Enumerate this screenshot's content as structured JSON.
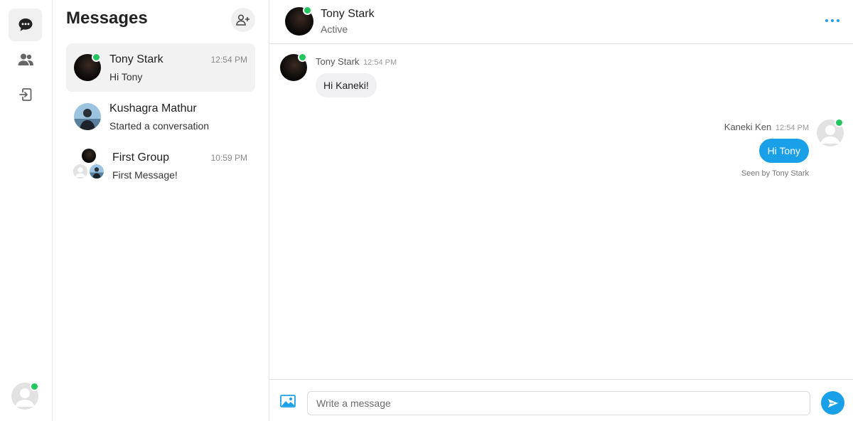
{
  "sidebar": {
    "nav": [
      {
        "icon": "chat-bubble-icon",
        "active": true
      },
      {
        "icon": "users-icon",
        "active": false
      },
      {
        "icon": "logout-icon",
        "active": false
      }
    ],
    "current_user": {
      "online": true
    }
  },
  "conversations": {
    "title": "Messages",
    "new_icon": "add-user-icon",
    "items": [
      {
        "name": "Tony Stark",
        "preview": "Hi Tony",
        "time": "12:54 PM",
        "online": true,
        "active": true
      },
      {
        "name": "Kushagra Mathur",
        "preview": "Started a conversation",
        "time": "",
        "online": false,
        "active": false
      },
      {
        "name": "First Group",
        "preview": "First Message!",
        "time": "10:59 PM",
        "online": false,
        "active": false
      }
    ]
  },
  "chat": {
    "header": {
      "name": "Tony Stark",
      "status": "Active"
    },
    "messages": [
      {
        "direction": "in",
        "sender": "Tony Stark",
        "time": "12:54 PM",
        "text": "Hi Kaneki!"
      },
      {
        "direction": "out",
        "sender": "Kaneki Ken",
        "time": "12:54 PM",
        "text": "Hi Tony",
        "seen": "Seen by Tony Stark"
      }
    ],
    "composer": {
      "placeholder": "Write a message",
      "value": ""
    }
  },
  "colors": {
    "accent": "#1aa0e8",
    "online": "#22c55e",
    "active_bg": "#f2f2f2"
  }
}
